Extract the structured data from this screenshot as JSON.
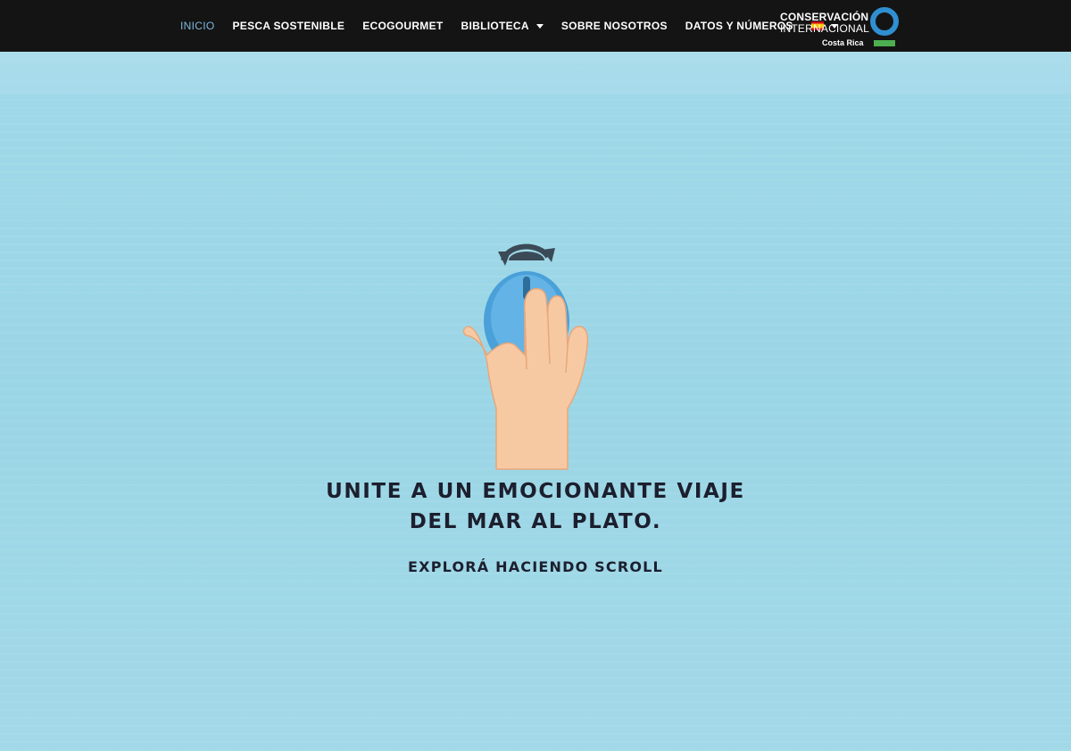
{
  "nav": {
    "items": [
      {
        "label": "INICIO",
        "active": true
      },
      {
        "label": "PESCA SOSTENIBLE"
      },
      {
        "label": "ECOGOURMET"
      },
      {
        "label": "BIBLIOTECA"
      },
      {
        "label": "SOBRE NOSOTROS"
      },
      {
        "label": "DATOS Y NÚMEROS"
      }
    ],
    "language_flag_icon": "spain-flag-icon"
  },
  "logo": {
    "line1": "CONSERVACIÓN",
    "line2": "INTERNACIONAL",
    "line3": "Costa Rica"
  },
  "hero": {
    "icon": "scroll-mouse-hand-icon",
    "headline_line1": "UNITE A UN EMOCIONANTE VIAJE",
    "headline_line2": "DEL MAR AL PLATO.",
    "subline": "EXPLORÁ HACIENDO SCROLL"
  },
  "colors": {
    "navbar_bg": "#141414",
    "active_nav": "#7fb7dc",
    "water": "#a5dcea",
    "text_dark": "#1c1f2e",
    "logo_ring": "#2f8fd1",
    "logo_bar": "#4caf50"
  }
}
